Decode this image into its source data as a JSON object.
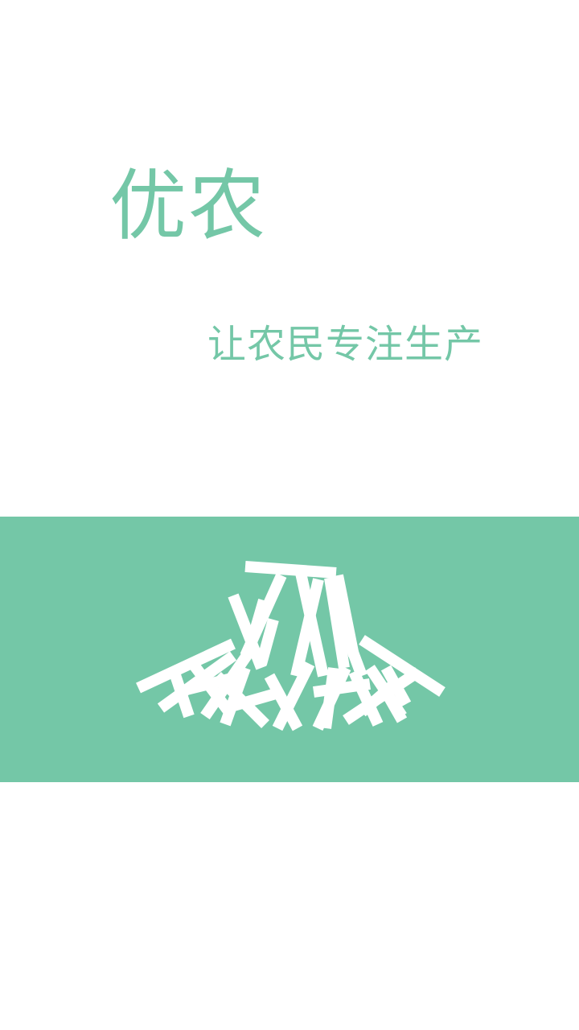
{
  "app": {
    "title": "优农",
    "slogan": "让农民专注生产"
  },
  "colors": {
    "brand_green": "#74c7a7",
    "background": "#ffffff",
    "logo_fill": "#ffffff"
  },
  "icons": {
    "logo": "woven-straw-pile-logo-icon"
  }
}
